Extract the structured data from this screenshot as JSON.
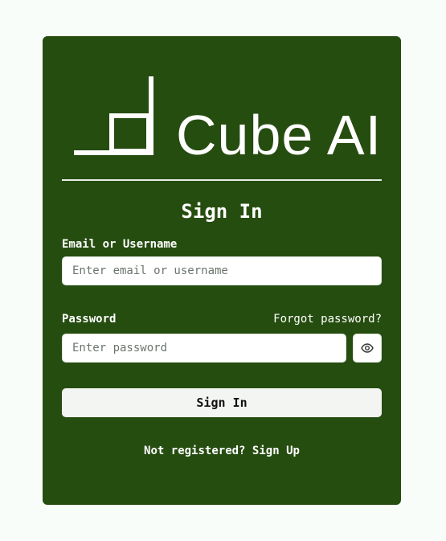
{
  "brand": {
    "name": "Cube AI",
    "logo_icon": "cube-logo-icon"
  },
  "form": {
    "title": "Sign In",
    "email_label": "Email or Username",
    "email_placeholder": "Enter email or username",
    "password_label": "Password",
    "forgot_password": "Forgot password?",
    "password_placeholder": "Enter password",
    "show_password_icon": "eye-icon",
    "submit_label": "Sign In"
  },
  "footer": {
    "prompt": "Not registered?",
    "signup_label": "Sign Up"
  },
  "colors": {
    "page_background": "#f8fdf9",
    "card_background": "#264d10",
    "text": "#ffffff",
    "button_background": "#f3f5f2"
  }
}
